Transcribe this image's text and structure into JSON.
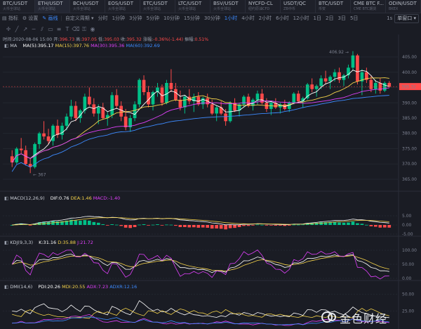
{
  "tabs": [
    {
      "name": "BTC/USDT",
      "sub": "火币全球站"
    },
    {
      "name": "ETH/USDT",
      "sub": "火币全球站",
      "active": true
    },
    {
      "name": "BCH/USDT",
      "sub": "火币全球站"
    },
    {
      "name": "EOS/USDT",
      "sub": "火币全球站"
    },
    {
      "name": "ETC/USDT",
      "sub": "火币全球站"
    },
    {
      "name": "LTC/USDT",
      "sub": "火币全球站"
    },
    {
      "name": "BSV/USDT",
      "sub": "火币全球站"
    },
    {
      "name": "NYCFD-CL",
      "sub": "纽约原油CFD"
    },
    {
      "name": "USDT/QC",
      "sub": "ZB中币"
    },
    {
      "name": "BTC/USDT",
      "sub": "币安"
    },
    {
      "name": "CME BTC F...",
      "sub": "CME BTC期货"
    },
    {
      "name": "ODIN/USDT",
      "sub": "BKEX"
    }
  ],
  "toolbar": {
    "indicators": "指标",
    "settings": "设置",
    "draw": "画线",
    "custom_period": "自定义周期",
    "periods": [
      "分时",
      "1分钟",
      "3分钟",
      "5分钟",
      "10分钟",
      "15分钟",
      "30分钟",
      "1小时",
      "4小时",
      "2小时",
      "6小时",
      "12小时",
      "1日",
      "2日",
      "3日",
      "5日"
    ],
    "active_period": "1小时",
    "right_1s": "1s",
    "right_mode": "单窗口"
  },
  "info": {
    "time_label": "时间:",
    "time": "2020-08-06 15:00",
    "open_label": "开:",
    "open": "396.73",
    "high_label": "高:",
    "high": "397.05",
    "low_label": "低:",
    "low": "395.03",
    "close_label": "收:",
    "close": "395.32",
    "change_label": "涨幅:",
    "change": "-0.36%(-1.44)",
    "amp_label": "振幅:",
    "amp": "0.51%"
  },
  "ma": {
    "label": "MA",
    "ma5": "MA(5):395.17",
    "ma15": "MA(15):397.76",
    "ma30": "MA(30):395.36",
    "ma60": "MA(60):392.69"
  },
  "macd": {
    "label": "MACD(12,26,9)",
    "dif": "DIF:0.76",
    "dea": "DEA:1.46",
    "macd": "MACD:-1.40"
  },
  "kdj": {
    "label": "KDJ(9,3,3)",
    "k": "K:31.16",
    "d": "D:35.88",
    "j": "J:21.72"
  },
  "dmi": {
    "label": "DMI(14,6)",
    "pdi": "PDI:20.26",
    "mdi": "MDI:20.55",
    "adx": "ADX:7.23",
    "adxr": "ADXR:12.16"
  },
  "price_axis": [
    "405.00",
    "400.00",
    "395.00",
    "390.00",
    "385.00",
    "380.00",
    "375.00",
    "370.00",
    "365.00"
  ],
  "current_price": "395.32",
  "high_marker": "406.92",
  "low_marker": "367",
  "macd_axis": [
    "5.00",
    "0.00",
    "-5.00"
  ],
  "kdj_axis": [
    "100.00",
    "50.00",
    "0.00"
  ],
  "dmi_axis": [
    "50.00",
    "25.00"
  ],
  "watermark": "金色财经",
  "colors": {
    "up": "#00c087",
    "down": "#ff4a4a",
    "ma5": "#ffffff",
    "ma15": "#f5d34a",
    "ma30": "#e040fb",
    "ma60": "#3d8bff",
    "accent": "#3d8bff"
  },
  "chart_data": {
    "type": "candlestick",
    "ylim": [
      362,
      408
    ],
    "candles": [
      [
        372.5,
        374.5,
        369.0,
        370.5
      ],
      [
        370.5,
        375.5,
        370.0,
        375.0
      ],
      [
        375.0,
        378.5,
        373.5,
        374.5
      ],
      [
        374.5,
        376.0,
        369.5,
        370.0
      ],
      [
        370.0,
        372.0,
        367.0,
        369.0
      ],
      [
        369.0,
        377.0,
        368.5,
        376.5
      ],
      [
        376.5,
        380.5,
        375.0,
        380.0
      ],
      [
        380.0,
        384.0,
        378.0,
        379.0
      ],
      [
        379.0,
        381.5,
        376.5,
        377.5
      ],
      [
        377.5,
        383.0,
        376.0,
        382.5
      ],
      [
        382.5,
        384.5,
        378.5,
        379.5
      ],
      [
        379.5,
        383.5,
        378.0,
        382.5
      ],
      [
        382.5,
        386.5,
        381.0,
        385.5
      ],
      [
        385.5,
        391.0,
        384.5,
        389.0
      ],
      [
        389.0,
        390.5,
        384.0,
        385.0
      ],
      [
        385.0,
        388.0,
        383.5,
        387.5
      ],
      [
        387.5,
        393.0,
        386.5,
        392.0
      ],
      [
        392.0,
        395.0,
        389.0,
        389.5
      ],
      [
        389.5,
        391.5,
        385.5,
        386.5
      ],
      [
        386.5,
        389.5,
        383.0,
        388.5
      ],
      [
        388.5,
        390.0,
        384.5,
        385.0
      ],
      [
        385.0,
        387.0,
        382.5,
        386.0
      ],
      [
        386.0,
        393.5,
        385.0,
        392.5
      ],
      [
        392.5,
        394.5,
        388.0,
        389.0
      ],
      [
        389.0,
        390.5,
        384.0,
        385.5
      ],
      [
        385.5,
        388.0,
        381.0,
        382.0
      ],
      [
        382.0,
        386.0,
        380.5,
        385.0
      ],
      [
        385.0,
        390.5,
        384.0,
        389.5
      ],
      [
        389.5,
        398.0,
        388.5,
        397.5
      ],
      [
        397.5,
        399.0,
        392.5,
        393.5
      ],
      [
        393.5,
        395.5,
        388.5,
        389.5
      ],
      [
        389.5,
        394.0,
        387.5,
        393.5
      ],
      [
        393.5,
        396.5,
        392.0,
        395.0
      ],
      [
        395.0,
        396.0,
        389.0,
        390.0
      ],
      [
        390.0,
        397.5,
        389.5,
        396.5
      ],
      [
        396.5,
        401.0,
        393.5,
        394.5
      ],
      [
        394.5,
        396.5,
        390.5,
        391.0
      ],
      [
        391.0,
        394.0,
        387.5,
        388.5
      ],
      [
        388.5,
        392.5,
        386.5,
        392.0
      ],
      [
        392.0,
        394.5,
        389.5,
        390.5
      ],
      [
        390.5,
        393.0,
        387.0,
        392.0
      ],
      [
        392.0,
        393.5,
        389.0,
        389.5
      ],
      [
        389.5,
        392.0,
        388.0,
        391.5
      ],
      [
        391.5,
        393.0,
        388.5,
        389.5
      ],
      [
        389.5,
        391.0,
        386.0,
        386.5
      ],
      [
        386.5,
        389.0,
        384.0,
        388.5
      ],
      [
        388.5,
        390.5,
        386.0,
        386.5
      ],
      [
        386.5,
        388.0,
        382.5,
        384.0
      ],
      [
        384.0,
        390.5,
        383.5,
        390.0
      ],
      [
        390.0,
        391.5,
        387.0,
        387.5
      ],
      [
        387.5,
        390.0,
        385.5,
        389.5
      ],
      [
        389.5,
        392.5,
        388.5,
        392.0
      ],
      [
        392.0,
        393.0,
        388.5,
        389.0
      ],
      [
        389.0,
        391.5,
        387.5,
        391.0
      ],
      [
        391.0,
        394.0,
        389.5,
        393.0
      ],
      [
        393.0,
        394.5,
        389.5,
        390.0
      ],
      [
        390.0,
        391.5,
        387.0,
        388.0
      ],
      [
        388.0,
        390.5,
        386.0,
        390.0
      ],
      [
        390.0,
        391.5,
        388.0,
        388.5
      ],
      [
        388.5,
        390.0,
        386.5,
        389.5
      ],
      [
        389.5,
        391.0,
        387.5,
        388.0
      ],
      [
        388.0,
        390.5,
        387.0,
        390.0
      ],
      [
        390.0,
        393.5,
        389.5,
        393.0
      ],
      [
        393.0,
        394.0,
        390.0,
        390.5
      ],
      [
        390.5,
        392.0,
        388.5,
        391.5
      ],
      [
        391.5,
        396.5,
        391.0,
        396.0
      ],
      [
        396.0,
        398.0,
        393.5,
        394.5
      ],
      [
        394.5,
        396.0,
        392.0,
        395.5
      ],
      [
        395.5,
        399.0,
        394.5,
        398.0
      ],
      [
        398.0,
        400.5,
        396.0,
        397.0
      ],
      [
        397.0,
        399.0,
        394.5,
        398.5
      ],
      [
        398.5,
        401.0,
        397.0,
        400.0
      ],
      [
        400.0,
        401.5,
        396.5,
        397.5
      ],
      [
        397.5,
        399.5,
        395.5,
        399.0
      ],
      [
        399.0,
        402.5,
        398.0,
        401.5
      ],
      [
        401.5,
        406.9,
        400.5,
        405.5
      ],
      [
        405.5,
        406.0,
        396.0,
        397.0
      ],
      [
        397.0,
        401.0,
        392.5,
        400.0
      ],
      [
        400.0,
        401.5,
        396.5,
        397.5
      ],
      [
        397.5,
        399.0,
        393.5,
        394.5
      ],
      [
        394.5,
        397.5,
        393.0,
        396.5
      ],
      [
        396.5,
        398.0,
        393.0,
        394.0
      ],
      [
        394.0,
        397.0,
        393.5,
        396.5
      ],
      [
        396.5,
        397.1,
        395.0,
        395.3
      ]
    ]
  }
}
